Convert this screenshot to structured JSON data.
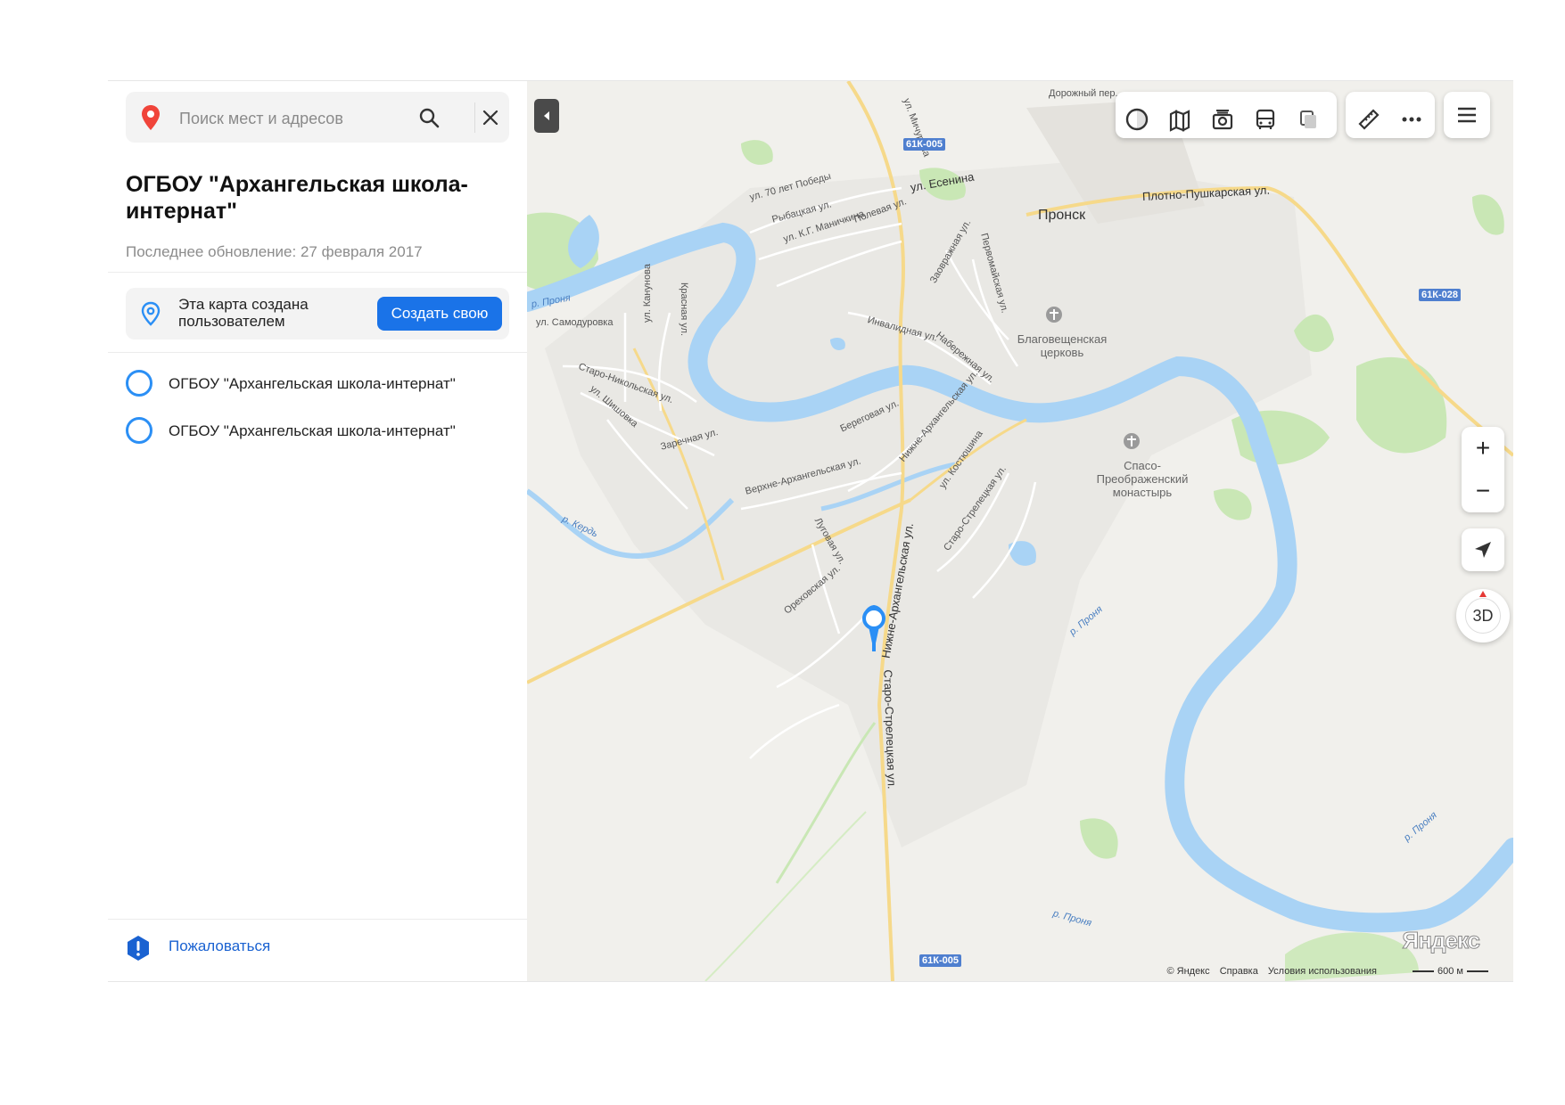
{
  "search": {
    "placeholder": "Поиск мест и адресов"
  },
  "map_info": {
    "title": "ОГБОУ \"Архангельская школа-интернат\"",
    "updated": "Последнее обновление: 27 февраля 2017"
  },
  "user_map": {
    "text": "Эта карта создана пользователем",
    "create_button": "Создать свою"
  },
  "objects": [
    {
      "label": "ОГБОУ \"Архангельская школа-интернат\""
    },
    {
      "label": "ОГБОУ \"Архангельская школа-интернат\""
    }
  ],
  "complain": {
    "label": "Пожаловаться"
  },
  "map": {
    "controls": {
      "zoom_in": "+",
      "zoom_out": "−",
      "view_3d": "3D"
    },
    "labels": {
      "town": "Пронск",
      "esenina": "ул. Есенина",
      "plotno": "Плотно-Пушкарская ул.",
      "dorozhny": "Дорожный пер.",
      "michurina": "ул. Мичурина",
      "victory": "ул. 70 лет Победы",
      "rybatskaya": "Рыбацкая ул.",
      "manichkina": "ул. К.Г. Маничкина",
      "polevaya": "Полевая ул.",
      "zavodskaya": "Заовражная ул.",
      "pervomayskaya": "Первомайская ул.",
      "invalidnaya": "Инвалидная ул.",
      "naberezhnaya": "Набережная ул.",
      "church": "Благовещенская церковь",
      "monastery": "Спасо-Преображенский монастырь",
      "samodurovka": "ул. Самодуровка",
      "kanunovka": "ул. Канунова",
      "krasnaya": "Красная ул.",
      "staronikolskaya": "Старо-Никольская ул.",
      "shishovka": "ул. Шишовка",
      "zarechnaya": "Заречная ул.",
      "beregovaya": "Береговая ул.",
      "nizhne_arch_upper": "Нижне-Архангельская ул.",
      "verkhne": "Верхне-Архангельская ул.",
      "kostyushina": "ул. Костюшина",
      "starostreletskaya": "Старо-Стрелецкая ул.",
      "lugovaya": "Луговая ул.",
      "orekhovskaya": "Ореховская ул.",
      "nizhne_arch_main": "Нижне-Архангельская ул.",
      "starostrel_main": "Старо-Стрелецкая ул.",
      "pronya_w": "р. Проня",
      "pronya_c": "р. Проня",
      "pronya_s": "р. Проня",
      "pronya_e": "р. Проня",
      "kerd": "р. Кердь"
    },
    "road_shields": {
      "north": "61К-005",
      "east": "61К-028",
      "south": "61К-005"
    },
    "copyright": {
      "yandex": "© Яндекс",
      "help": "Справка",
      "terms": "Условия использования"
    },
    "scale": "600 м",
    "logo": "Яндекс",
    "colors": {
      "water": "#a9d3f5",
      "forest": "#c9e7b5",
      "road_major": "#f6d98a",
      "accent": "#1a73e8",
      "marker": "#2b8ff5"
    }
  }
}
